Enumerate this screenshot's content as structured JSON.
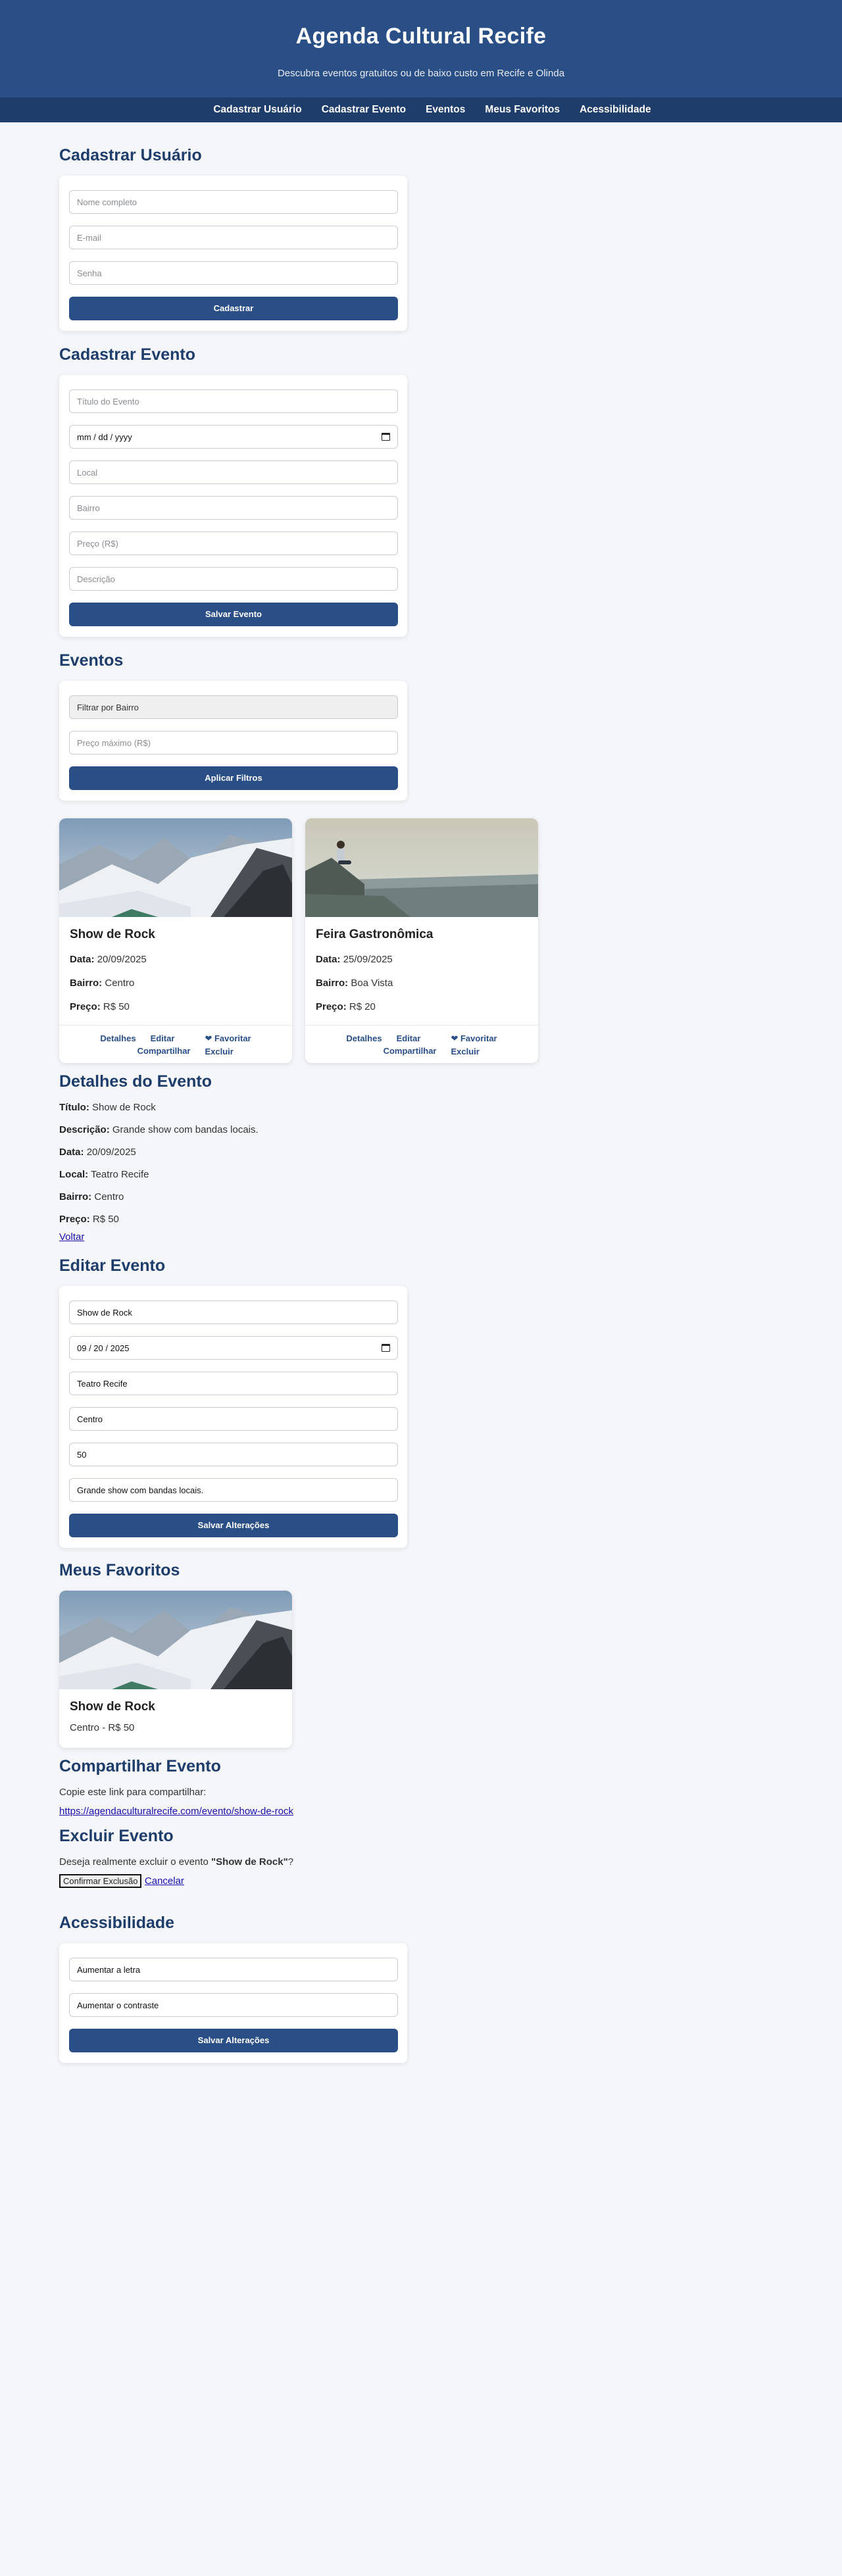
{
  "header": {
    "title": "Agenda Cultural Recife",
    "subtitle": "Descubra eventos gratuitos ou de baixo custo em Recife e Olinda"
  },
  "nav": [
    "Cadastrar Usuário",
    "Cadastrar Evento",
    "Eventos",
    "Meus Favoritos",
    "Acessibilidade"
  ],
  "cadastrar_usuario": {
    "heading": "Cadastrar Usuário",
    "nome_placeholder": "Nome completo",
    "email_placeholder": "E-mail",
    "senha_placeholder": "Senha",
    "button": "Cadastrar"
  },
  "cadastrar_evento": {
    "heading": "Cadastrar Evento",
    "titulo_placeholder": "Título do Evento",
    "data_placeholder": "mm / dd / yyyy",
    "local_placeholder": "Local",
    "bairro_placeholder": "Bairro",
    "preco_placeholder": "Preço (R$)",
    "descricao_placeholder": "Descrição",
    "button": "Salvar Evento"
  },
  "eventos": {
    "heading": "Eventos",
    "filtro_bairro": "Filtrar por Bairro",
    "preco_max_placeholder": "Preço máximo (R$)",
    "button": "Aplicar Filtros",
    "labels": {
      "data": "Data:",
      "bairro": "Bairro:",
      "preco": "Preço:"
    },
    "actions": {
      "detalhes": "Detalhes",
      "editar": "Editar",
      "compartilhar": "Compartilhar",
      "favoritar": "❤ Favoritar",
      "excluir": "Excluir"
    },
    "cards": [
      {
        "title": "Show de Rock",
        "data": "20/09/2025",
        "bairro": "Centro",
        "preco": "R$ 50",
        "image": "snowy-mountains"
      },
      {
        "title": "Feira Gastronômica",
        "data": "25/09/2025",
        "bairro": "Boa Vista",
        "preco": "R$ 20",
        "image": "person-sitting-on-cliff"
      }
    ]
  },
  "detalhes": {
    "heading": "Detalhes do Evento",
    "titulo_label": "Título:",
    "titulo": "Show de Rock",
    "descricao_label": "Descrição:",
    "descricao": "Grande show com bandas locais.",
    "data_label": "Data:",
    "data": "20/09/2025",
    "local_label": "Local:",
    "local": "Teatro Recife",
    "bairro_label": "Bairro:",
    "bairro": "Centro",
    "preco_label": "Preço:",
    "preco": "R$ 50",
    "voltar": "Voltar"
  },
  "editar": {
    "heading": "Editar Evento",
    "titulo": "Show de Rock",
    "data": "09 / 20 / 2025",
    "local": "Teatro Recife",
    "bairro": "Centro",
    "preco": "50",
    "descricao": "Grande show com bandas locais.",
    "button": "Salvar Alterações"
  },
  "favoritos": {
    "heading": "Meus Favoritos",
    "title": "Show de Rock",
    "info": "Centro - R$ 50",
    "image": "snowy-mountains"
  },
  "compartilhar": {
    "heading": "Compartilhar Evento",
    "text": "Copie este link para compartilhar:",
    "link": "https://agendaculturalrecife.com/evento/show-de-rock"
  },
  "excluir": {
    "heading": "Excluir Evento",
    "text_before": "Deseja realmente excluir o evento ",
    "event": "\"Show de Rock\"",
    "text_after": "?",
    "confirm": "Confirmar Exclusão",
    "cancel": "Cancelar"
  },
  "acessibilidade": {
    "heading": "Acessibilidade",
    "aumentar_letra": "Aumentar a letra",
    "aumentar_contraste": "Aumentar o contraste",
    "button": "Salvar Alterações"
  }
}
